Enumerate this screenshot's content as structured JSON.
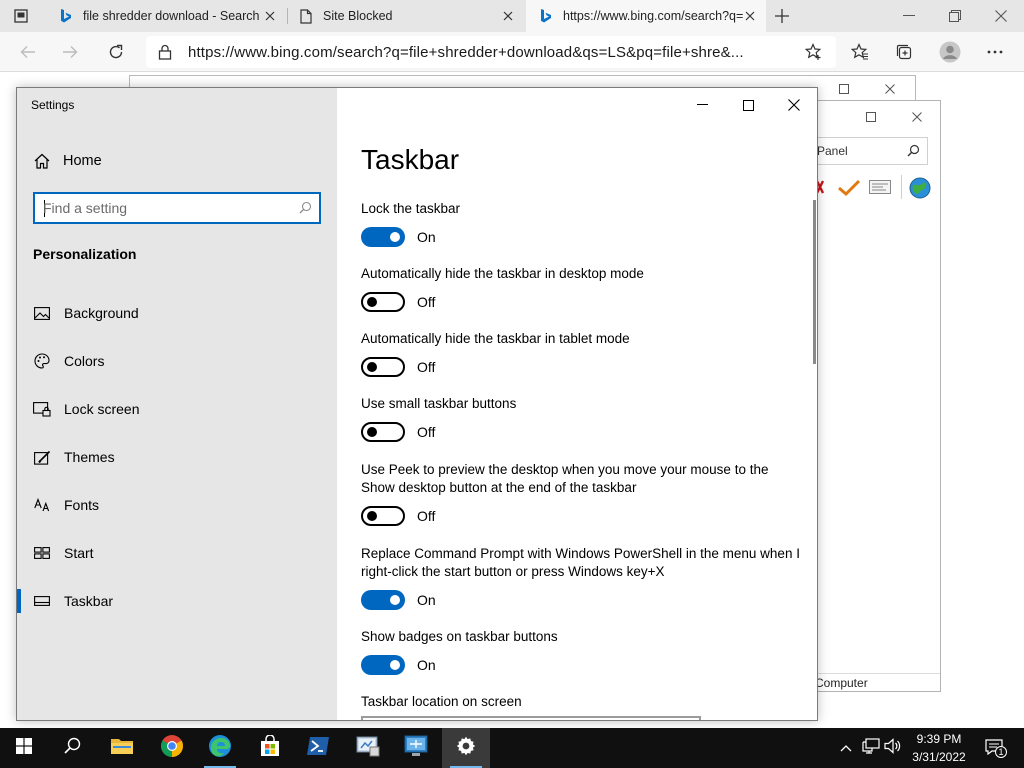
{
  "browser": {
    "tabs": [
      {
        "title": "file shredder download - Search",
        "favicon": "bing-icon",
        "active": false
      },
      {
        "title": "Site Blocked",
        "favicon": "page-icon",
        "active": false
      },
      {
        "title": "https://www.bing.com/search?q=",
        "favicon": "bing-icon",
        "active": true
      }
    ],
    "address": "https://www.bing.com/search?q=file+shredder+download&qs=LS&pq=file+shre&..."
  },
  "background_window": {
    "search_placeholder": "Panel",
    "status_text": "Computer"
  },
  "settings": {
    "window_title": "Settings",
    "home_label": "Home",
    "search_placeholder": "Find a setting",
    "section_title": "Personalization",
    "nav": [
      {
        "label": "Background",
        "icon": "picture-icon",
        "selected": false
      },
      {
        "label": "Colors",
        "icon": "palette-icon",
        "selected": false
      },
      {
        "label": "Lock screen",
        "icon": "lock-screen-icon",
        "selected": false
      },
      {
        "label": "Themes",
        "icon": "themes-icon",
        "selected": false
      },
      {
        "label": "Fonts",
        "icon": "fonts-icon",
        "selected": false
      },
      {
        "label": "Start",
        "icon": "start-icon",
        "selected": false
      },
      {
        "label": "Taskbar",
        "icon": "taskbar-icon",
        "selected": true
      }
    ],
    "page_title": "Taskbar",
    "options": [
      {
        "label": "Lock the taskbar",
        "state": "On",
        "on": true
      },
      {
        "label": "Automatically hide the taskbar in desktop mode",
        "state": "Off",
        "on": false
      },
      {
        "label": "Automatically hide the taskbar in tablet mode",
        "state": "Off",
        "on": false
      },
      {
        "label": "Use small taskbar buttons",
        "state": "Off",
        "on": false
      },
      {
        "label": "Use Peek to preview the desktop when you move your mouse to the Show desktop button at the end of the taskbar",
        "state": "Off",
        "on": false
      },
      {
        "label": "Replace Command Prompt with Windows PowerShell in the menu when I right-click the start button or press Windows key+X",
        "state": "On",
        "on": true
      },
      {
        "label": "Show badges on taskbar buttons",
        "state": "On",
        "on": true
      }
    ],
    "location_label": "Taskbar location on screen"
  },
  "taskbar": {
    "time": "9:39 PM",
    "date": "3/31/2022",
    "notification_count": "1",
    "apps": [
      "start-icon",
      "search-icon",
      "file-explorer-icon",
      "chrome-icon",
      "edge-icon",
      "store-icon",
      "powershell-icon",
      "control-panel-icon",
      "remote-desktop-icon",
      "settings-gear-icon"
    ]
  },
  "colors": {
    "accent": "#0067c0",
    "sidebar_bg": "#e6e6e6",
    "taskbar_bg": "#101010"
  }
}
